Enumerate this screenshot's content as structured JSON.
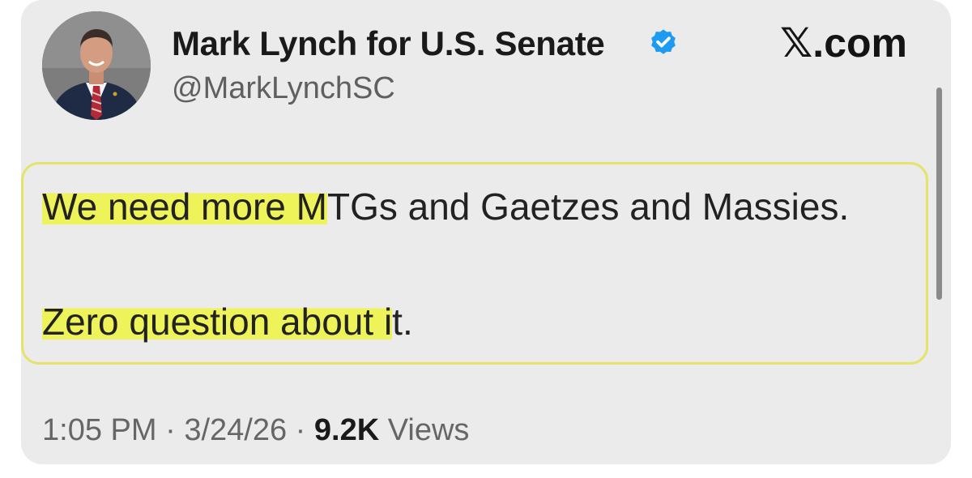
{
  "profile": {
    "display_name": "Mark Lynch for U.S. Senate",
    "handle": "@MarkLynchSC",
    "verified": true,
    "avatar_icon": "profile-photo"
  },
  "site_label": {
    "x_glyph": "𝕏",
    "suffix": ".com"
  },
  "tweet": {
    "line1_highlighted": "We need more M",
    "line1_rest": "TGs and Gaetzes and Massies.",
    "line2_highlighted": "Zero question about i",
    "line2_rest": "t."
  },
  "meta": {
    "time": "1:05 PM",
    "separator": " · ",
    "date": "3/24/26",
    "views_count": "9.2K",
    "views_label": " Views"
  },
  "colors": {
    "card_background": "#ebebeb",
    "highlight": "#eef35a",
    "box_border": "#e4e36a",
    "verified_badge": "#1d9bf0"
  }
}
